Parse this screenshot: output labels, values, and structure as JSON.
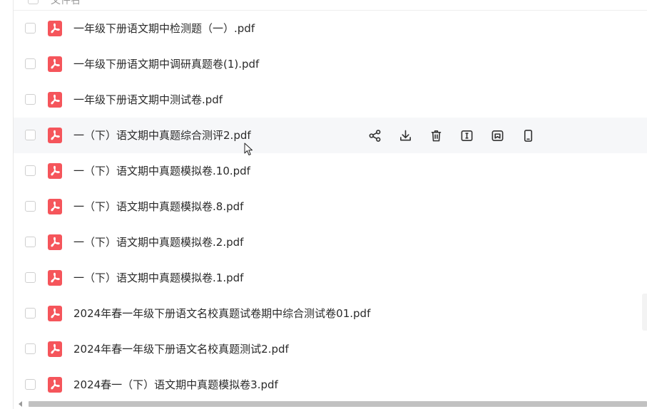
{
  "header": {
    "label": "文件名"
  },
  "files": [
    {
      "name": "一年级下册语文期中检测题（一）.pdf"
    },
    {
      "name": "一年级下册语文期中调研真题卷(1).pdf"
    },
    {
      "name": "一年级下册语文期中测试卷.pdf"
    },
    {
      "name": "一（下）语文期中真题综合测评2.pdf"
    },
    {
      "name": "一（下）语文期中真题模拟卷.10.pdf"
    },
    {
      "name": "一（下）语文期中真题模拟卷.8.pdf"
    },
    {
      "name": "一（下）语文期中真题模拟卷.2.pdf"
    },
    {
      "name": "一（下）语文期中真题模拟卷.1.pdf"
    },
    {
      "name": "2024年春一年级下册语文名校真题试卷期中综合测试卷01.pdf"
    },
    {
      "name": "2024年春一年级下册语文名校真题测试2.pdf"
    },
    {
      "name": "2024春一（下）语文期中真题模拟卷3.pdf"
    }
  ],
  "hovered_row_index": 3,
  "row_actions": [
    "share-icon",
    "download-icon",
    "delete-icon",
    "rename-icon",
    "save-to-icon",
    "send-to-phone-icon"
  ],
  "colors": {
    "pdf_red": "#f5555b",
    "hover_bg": "#f6f7f9",
    "icon": "#333333"
  }
}
